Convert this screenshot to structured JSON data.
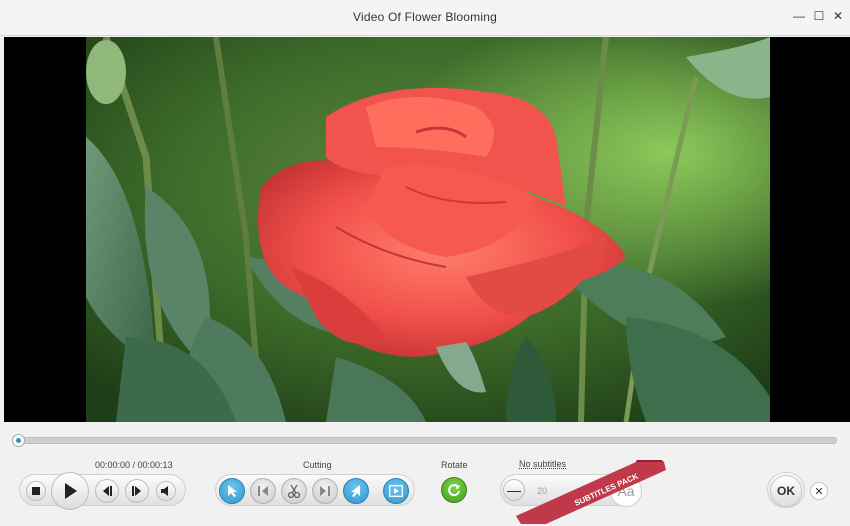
{
  "window": {
    "title": "Video Of Flower Blooming",
    "minimize_glyph": "—",
    "maximize_glyph": "☐",
    "close_glyph": "✕"
  },
  "video": {
    "subject": "red rose"
  },
  "playback": {
    "time": "00:00:00 / 00:00:13",
    "progress": 0.0
  },
  "cutting": {
    "label": "Cutting"
  },
  "rotate": {
    "label": "Rotate"
  },
  "subtitles": {
    "label": "No subtitles",
    "minus_glyph": "—",
    "size": "20",
    "font_glyph": "Aa",
    "ribbon_text": "SUBTITLES PACK"
  },
  "actions": {
    "ok_label": "OK",
    "close_glyph": "✕"
  },
  "colors": {
    "accent_blue": "#2f98cf",
    "rotate_green": "#3e9e1c",
    "ribbon_red": "#c0394a"
  }
}
